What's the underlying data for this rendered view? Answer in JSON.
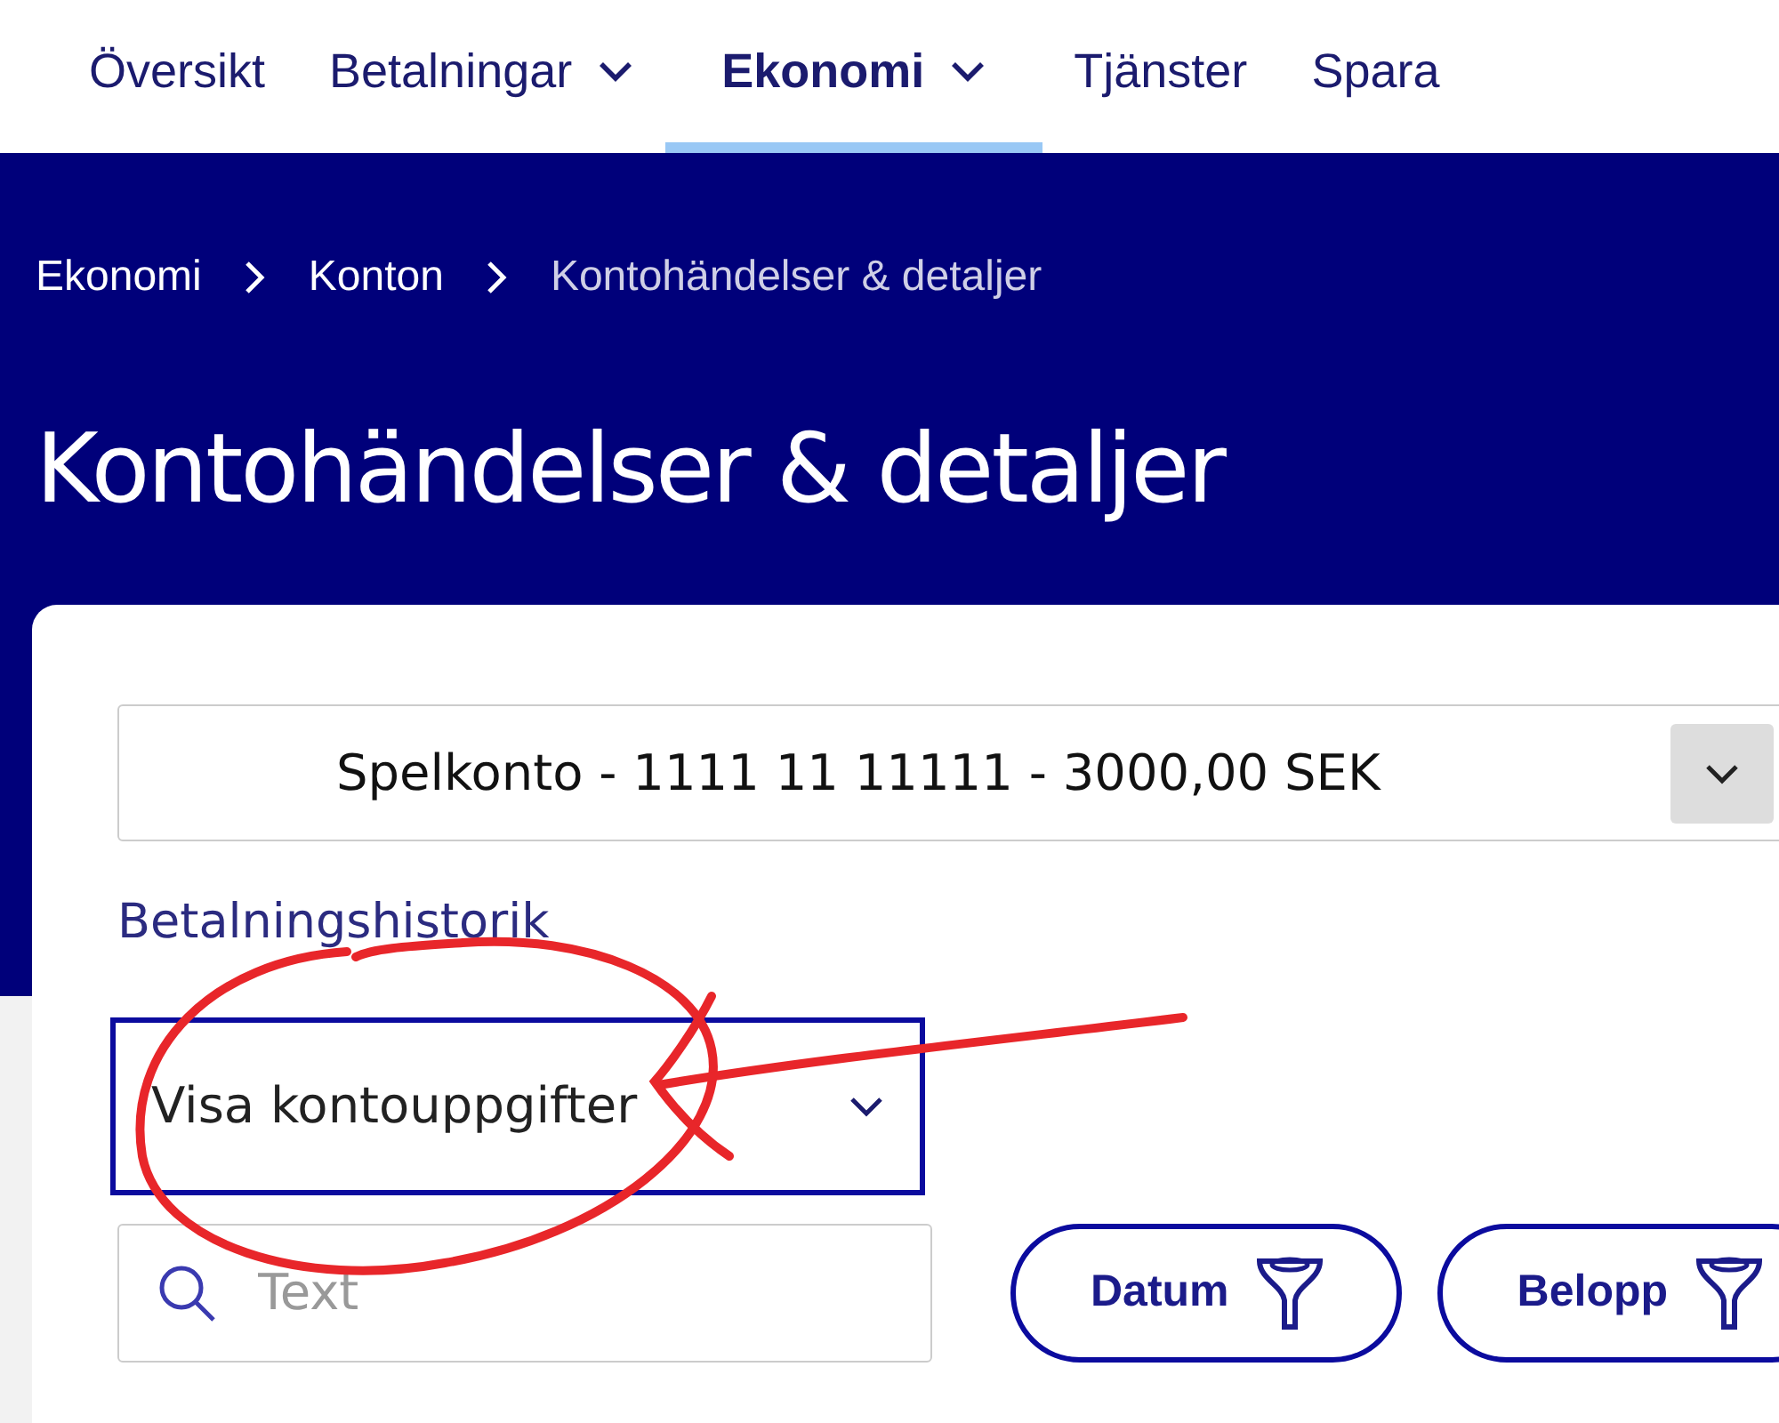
{
  "nav": [
    {
      "label": "Översikt",
      "dropdown": false,
      "selected": false
    },
    {
      "label": "Betalningar",
      "dropdown": true,
      "selected": false
    },
    {
      "label": "Ekonomi",
      "dropdown": true,
      "selected": true
    },
    {
      "label": "Tjänster",
      "dropdown": false,
      "selected": false
    },
    {
      "label": "Spara",
      "dropdown": false,
      "selected": false
    }
  ],
  "breadcrumb": [
    {
      "label": "Ekonomi",
      "current": false
    },
    {
      "label": "Konton",
      "current": false
    },
    {
      "label": "Kontohändelser & detaljer",
      "current": true
    }
  ],
  "page_title": "Kontohändelser & detaljer",
  "account_select": {
    "value": "Spelkonto - 1111 11 11111 - 3000,00 SEK"
  },
  "history_label": "Betalningshistorik",
  "view_select": {
    "value": "Visa kontouppgifter",
    "focused": true
  },
  "search": {
    "placeholder": "Text"
  },
  "filters": [
    "Datum",
    "Belopp"
  ]
}
